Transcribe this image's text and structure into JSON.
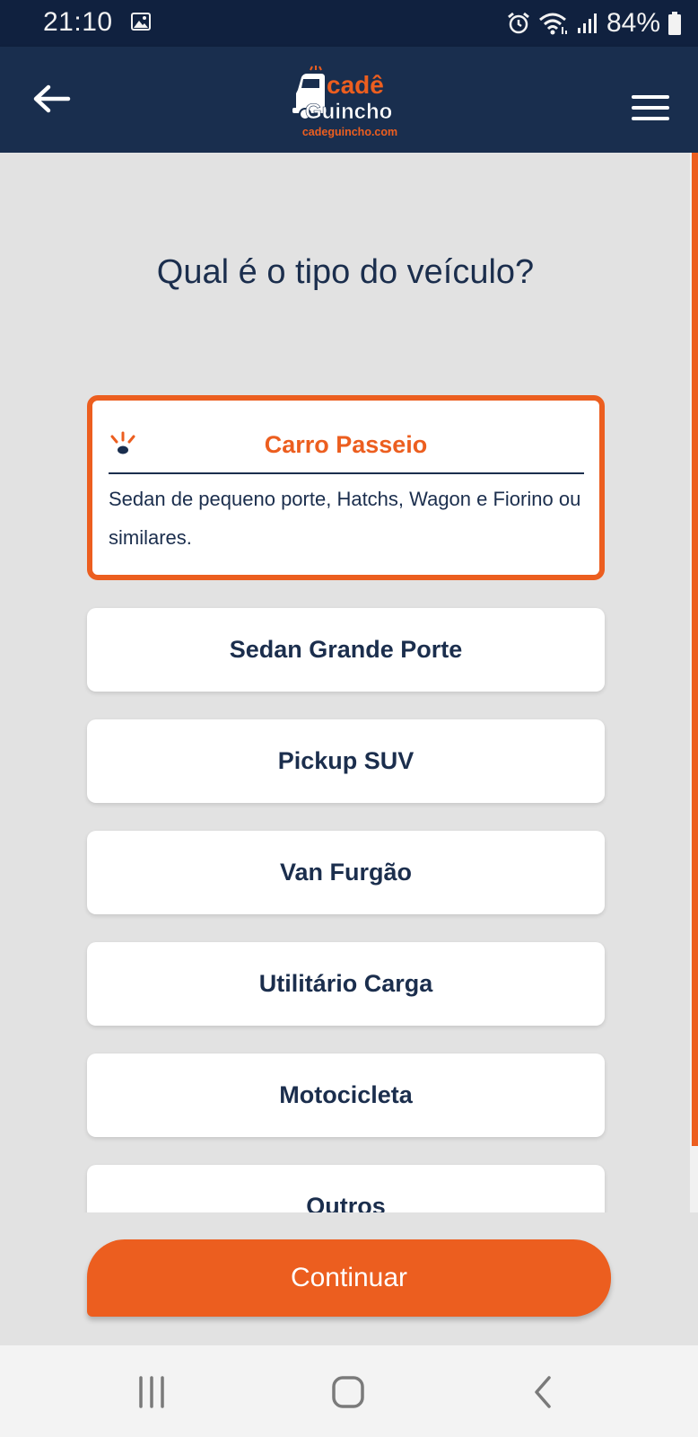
{
  "status_bar": {
    "time": "21:10",
    "battery": "84%"
  },
  "app_bar": {
    "logo_text_top": "cadê",
    "logo_text_bottom": "Guincho",
    "logo_url": "cadeguincho.com"
  },
  "question": "Qual é o tipo do veículo?",
  "vehicle_types": [
    {
      "label": "Carro Passeio",
      "description": "Sedan de pequeno porte, Hatchs, Wagon e Fiorino ou similares.",
      "selected": true
    },
    {
      "label": "Sedan Grande Porte"
    },
    {
      "label": "Pickup SUV"
    },
    {
      "label": "Van Furgão"
    },
    {
      "label": "Utilitário Carga"
    },
    {
      "label": "Motocicleta"
    },
    {
      "label": "Outros"
    }
  ],
  "continue_label": "Continuar",
  "colors": {
    "accent": "#ec5e1f",
    "navy": "#192e4e",
    "text": "#1b2e4d",
    "background": "#e2e2e2"
  }
}
